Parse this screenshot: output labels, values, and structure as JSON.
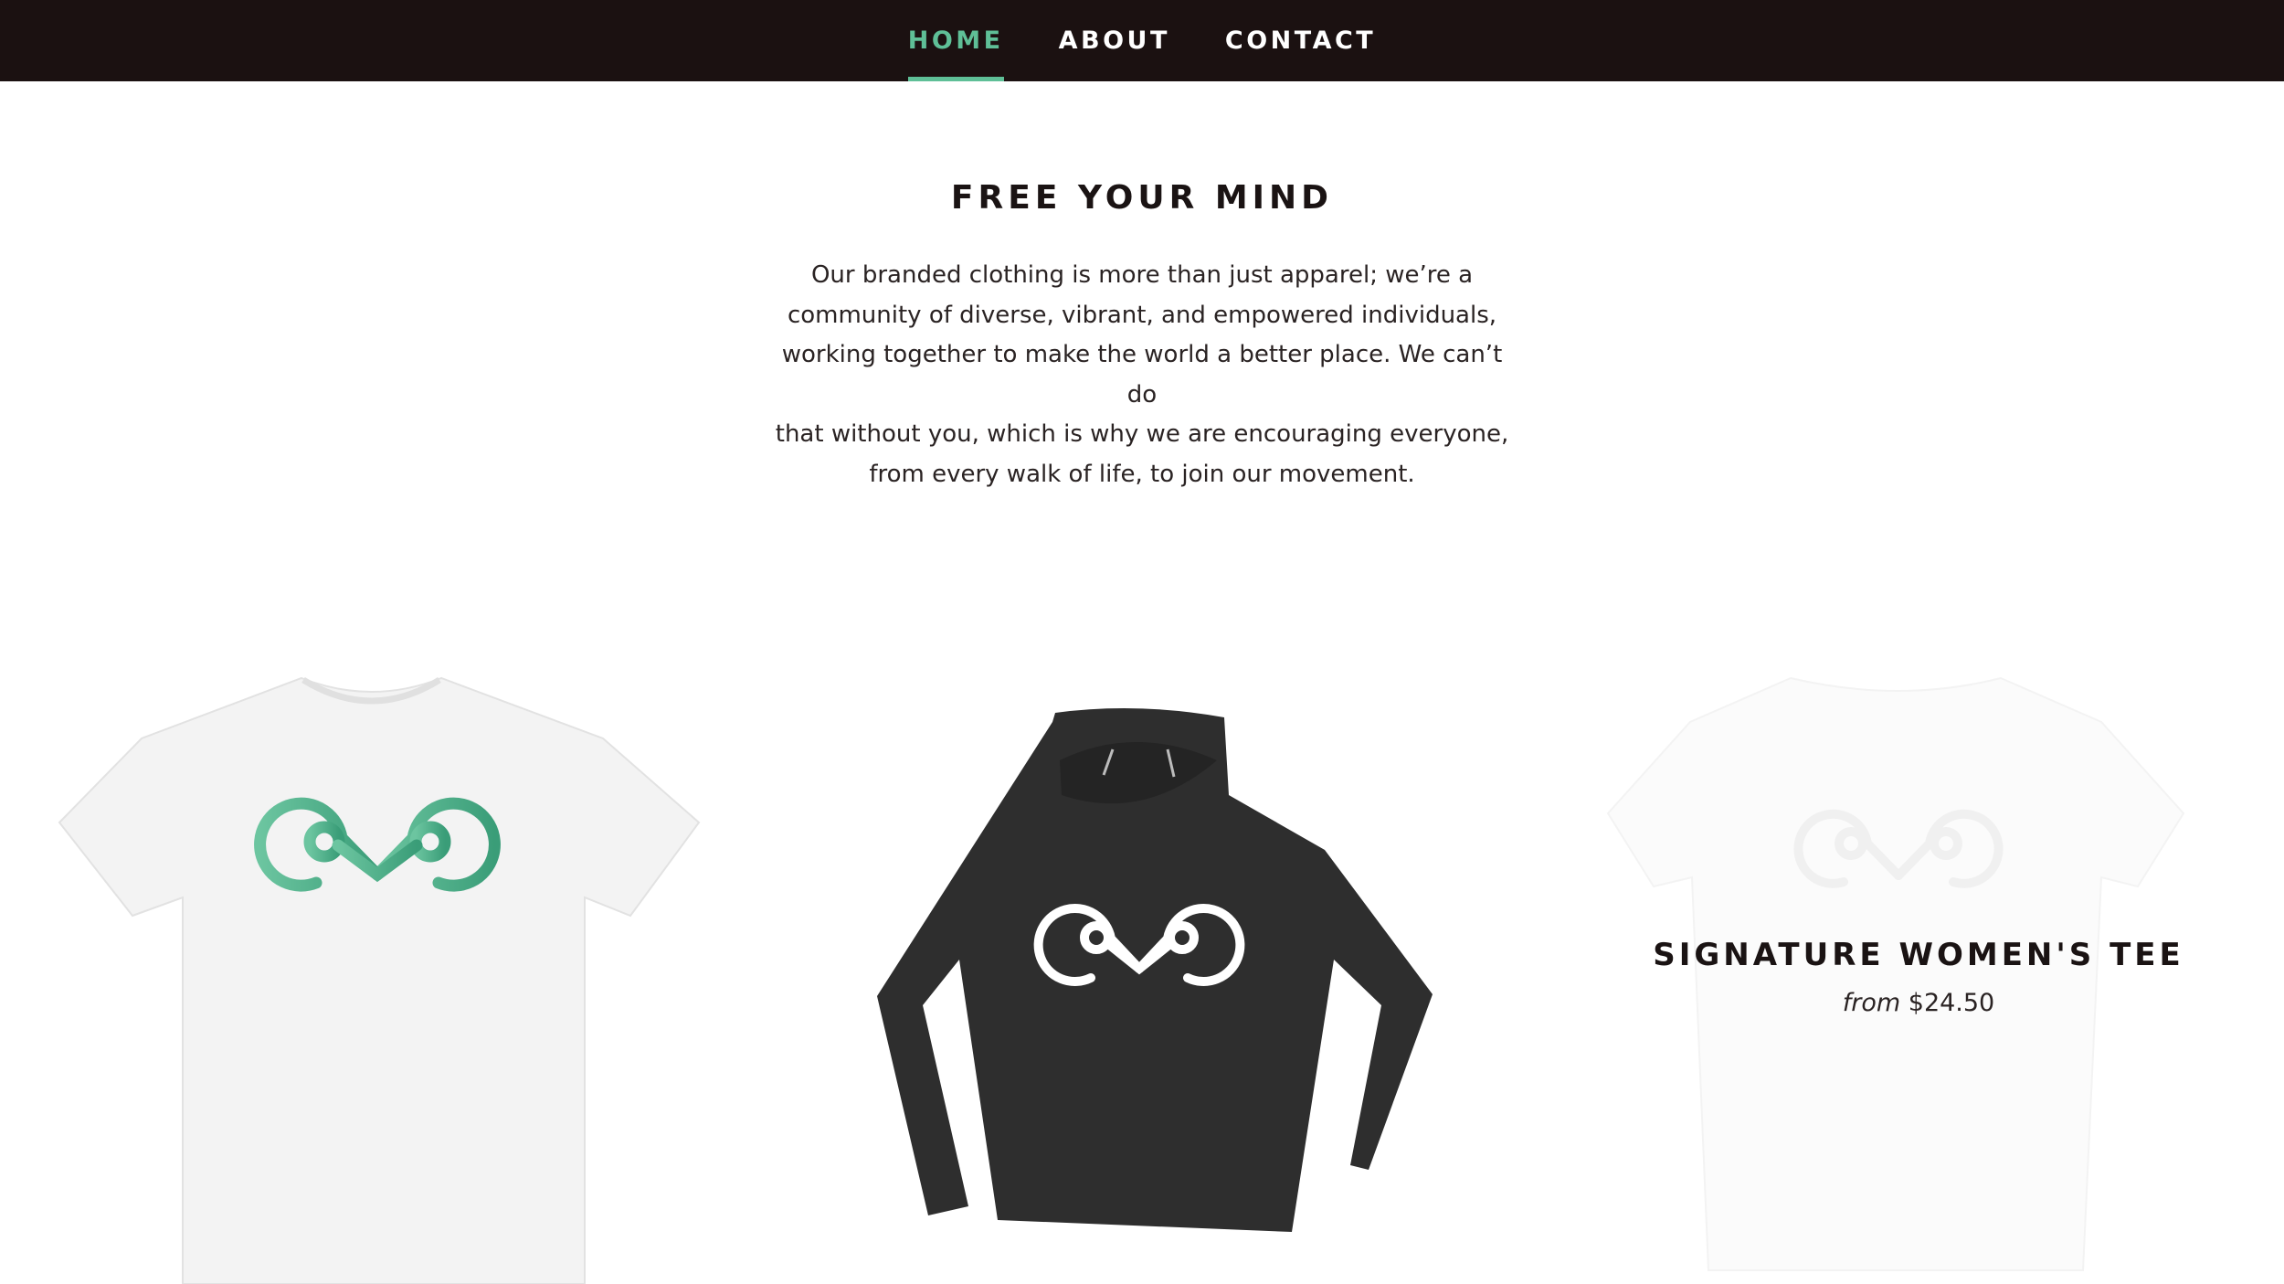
{
  "nav": {
    "items": [
      {
        "label": "HOME",
        "active": true
      },
      {
        "label": "ABOUT",
        "active": false
      },
      {
        "label": "CONTACT",
        "active": false
      }
    ],
    "accent_color": "#5fbf97",
    "background_color": "#1b1111"
  },
  "hero": {
    "title": "FREE YOUR MIND",
    "lines": [
      "Our branded clothing is more than just apparel; we’re a",
      "community of diverse, vibrant, and empowered individuals,",
      "working together to make the world a better place. We can’t do",
      "that without you, which is why we are encouraging everyone,",
      "from every walk of life, to join our movement."
    ]
  },
  "products": [
    {
      "image": "white-tshirt-green-logo",
      "title": "",
      "price_prefix": "",
      "price": ""
    },
    {
      "image": "black-hoodie-white-logo",
      "title": "",
      "price_prefix": "",
      "price": ""
    },
    {
      "image": "white-womens-tee-faded",
      "title": "SIGNATURE WOMEN'S TEE",
      "price_prefix": "from",
      "price": "$24.50"
    }
  ]
}
